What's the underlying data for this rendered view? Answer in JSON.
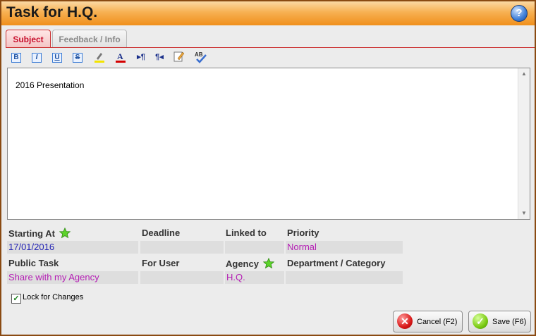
{
  "window": {
    "title": "Task for H.Q."
  },
  "tabs": [
    {
      "label": "Subject",
      "active": true
    },
    {
      "label": "Feedback / Info",
      "active": false
    }
  ],
  "toolbar": {
    "bold": "B",
    "italic": "I",
    "underline": "U",
    "strike": "S",
    "highlight_icon": "highlight-pen-icon",
    "font_color_icon": "font-color-icon",
    "ltr_icon": "ltr-paragraph-icon",
    "rtl_icon": "rtl-paragraph-icon",
    "edit_icon": "edit-note-icon",
    "spellcheck": "AB"
  },
  "editor": {
    "content": "2016 Presentation"
  },
  "fields": {
    "starting_at": {
      "label": "Starting At",
      "value": "17/01/2016"
    },
    "deadline": {
      "label": "Deadline",
      "value": ""
    },
    "linked_to": {
      "label": "Linked to",
      "value": ""
    },
    "priority": {
      "label": "Priority",
      "value": "Normal"
    },
    "public_task": {
      "label": "Public Task",
      "value": "Share with my Agency"
    },
    "for_user": {
      "label": "For User",
      "value": ""
    },
    "agency": {
      "label": "Agency",
      "value": "H.Q."
    },
    "department": {
      "label": "Department / Category",
      "value": ""
    }
  },
  "lock": {
    "label": "Lock for Changes",
    "checked": true
  },
  "buttons": {
    "cancel": "Cancel  (F2)",
    "save": "Save  (F6)"
  },
  "colors": {
    "accent": "#f0901c",
    "tab_active": "#c8102e",
    "value_blue": "#2323b4",
    "value_purple": "#b51fb5"
  }
}
